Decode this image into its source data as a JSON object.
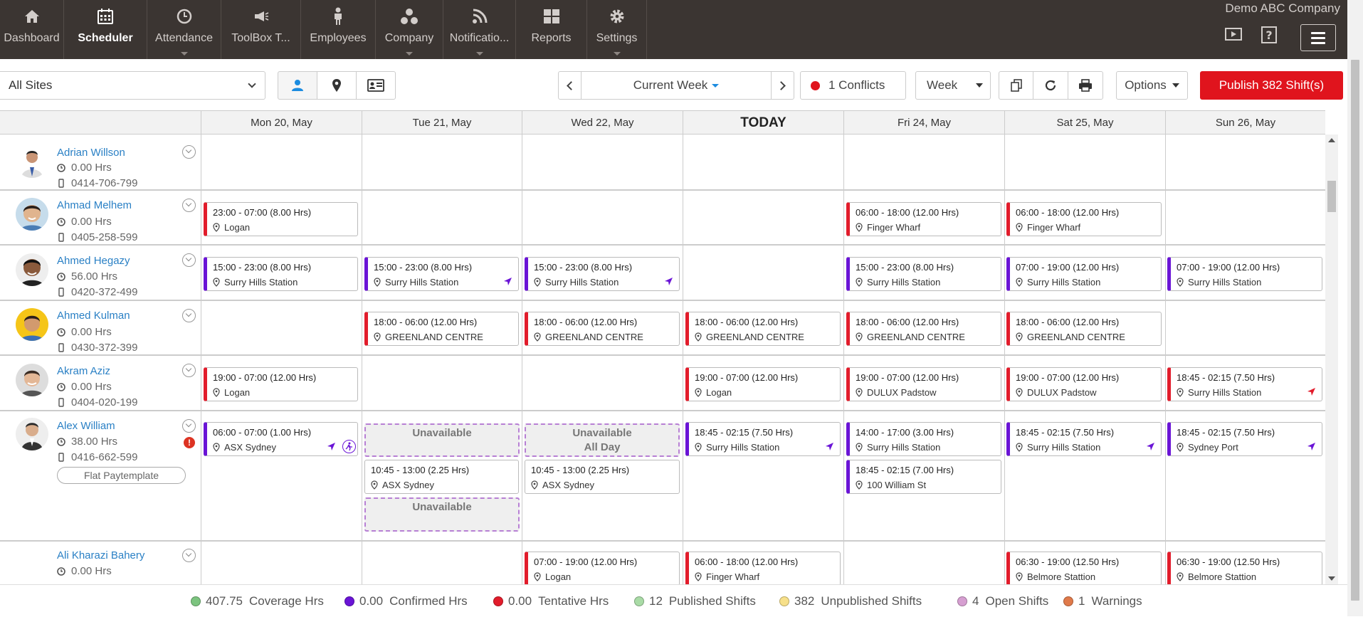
{
  "nav": {
    "items": [
      {
        "label": "Dashboard",
        "icon": "home-icon"
      },
      {
        "label": "Scheduler",
        "icon": "calendar-icon"
      },
      {
        "label": "Attendance",
        "icon": "clock-icon"
      },
      {
        "label": "ToolBox T...",
        "icon": "megaphone-icon"
      },
      {
        "label": "Employees",
        "icon": "person-icon"
      },
      {
        "label": "Company",
        "icon": "company-icon"
      },
      {
        "label": "Notificatio...",
        "icon": "rss-icon"
      },
      {
        "label": "Reports",
        "icon": "grid-icon"
      },
      {
        "label": "Settings",
        "icon": "gear-icon"
      }
    ],
    "company": "Demo ABC Company"
  },
  "toolbar": {
    "site": "All Sites",
    "week_label": "Current Week",
    "conflicts": "1 Conflicts",
    "view": "Week",
    "options": "Options",
    "publish": "Publish 382 Shift(s)"
  },
  "days": [
    "Mon 20, May",
    "Tue 21, May",
    "Wed 22, May",
    "TODAY",
    "Fri 24, May",
    "Sat 25, May",
    "Sun 26, May"
  ],
  "employees": [
    {
      "name": "Adrian Willson",
      "hrs": "0.00 Hrs",
      "phone": "0414-706-799"
    },
    {
      "name": "Ahmad Melhem",
      "hrs": "0.00 Hrs",
      "phone": "0405-258-599"
    },
    {
      "name": "Ahmed Hegazy",
      "hrs": "56.00 Hrs",
      "phone": "0420-372-499"
    },
    {
      "name": "Ahmed Kulman",
      "hrs": "0.00 Hrs",
      "phone": "0430-372-399"
    },
    {
      "name": "Akram Aziz",
      "hrs": "0.00 Hrs",
      "phone": "0404-020-199"
    },
    {
      "name": "Alex William",
      "hrs": "38.00 Hrs",
      "phone": "0416-662-599",
      "paytemplate": "Flat Paytemplate"
    },
    {
      "name": "Ali Kharazi Bahery",
      "hrs": "0.00 Hrs"
    }
  ],
  "shifts": [
    {
      "time": "23:00 - 07:00 (8.00 Hrs)",
      "loc": "Logan"
    },
    {
      "time": "06:00 - 18:00 (12.00 Hrs)",
      "loc": "Finger Wharf"
    },
    {
      "time": "06:00 - 18:00 (12.00 Hrs)",
      "loc": "Finger Wharf"
    },
    {
      "time": "15:00 - 23:00 (8.00 Hrs)",
      "loc": "Surry Hills Station"
    },
    {
      "time": "15:00 - 23:00 (8.00 Hrs)",
      "loc": "Surry Hills Station"
    },
    {
      "time": "15:00 - 23:00 (8.00 Hrs)",
      "loc": "Surry Hills Station"
    },
    {
      "time": "15:00 - 23:00 (8.00 Hrs)",
      "loc": "Surry Hills Station"
    },
    {
      "time": "07:00 - 19:00 (12.00 Hrs)",
      "loc": "Surry Hills Station"
    },
    {
      "time": "07:00 - 19:00 (12.00 Hrs)",
      "loc": "Surry Hills Station"
    },
    {
      "time": "18:00 - 06:00 (12.00 Hrs)",
      "loc": "GREENLAND CENTRE"
    },
    {
      "time": "18:00 - 06:00 (12.00 Hrs)",
      "loc": "GREENLAND CENTRE"
    },
    {
      "time": "18:00 - 06:00 (12.00 Hrs)",
      "loc": "GREENLAND CENTRE"
    },
    {
      "time": "18:00 - 06:00 (12.00 Hrs)",
      "loc": "GREENLAND CENTRE"
    },
    {
      "time": "18:00 - 06:00 (12.00 Hrs)",
      "loc": "GREENLAND CENTRE"
    },
    {
      "time": "19:00 - 07:00 (12.00 Hrs)",
      "loc": "Logan"
    },
    {
      "time": "19:00 - 07:00 (12.00 Hrs)",
      "loc": "Logan"
    },
    {
      "time": "19:00 - 07:00 (12.00 Hrs)",
      "loc": "DULUX Padstow"
    },
    {
      "time": "19:00 - 07:00 (12.00 Hrs)",
      "loc": "DULUX Padstow"
    },
    {
      "time": "18:45 - 02:15 (7.50 Hrs)",
      "loc": "Surry Hills Station"
    },
    {
      "time": "06:00 - 07:00 (1.00 Hrs)",
      "loc": "ASX Sydney"
    },
    {
      "time": "18:45 - 02:15 (7.50 Hrs)",
      "loc": "Surry Hills Station"
    },
    {
      "time": "14:00 - 17:00 (3.00 Hrs)",
      "loc": "Surry Hills Station"
    },
    {
      "time": "18:45 - 02:15 (7.50 Hrs)",
      "loc": "Surry Hills Station"
    },
    {
      "time": "18:45 - 02:15 (7.50 Hrs)",
      "loc": "Sydney Port"
    },
    {
      "time": "10:45 - 13:00 (2.25 Hrs)",
      "loc": "ASX Sydney"
    },
    {
      "time": "10:45 - 13:00 (2.25 Hrs)",
      "loc": "ASX Sydney"
    },
    {
      "time": "18:45 - 02:15 (7.00 Hrs)",
      "loc": "100 William St"
    },
    {
      "time": "07:00 - 19:00 (12.00 Hrs)",
      "loc": "Logan"
    },
    {
      "time": "06:00 - 18:00 (12.00 Hrs)",
      "loc": "Finger Wharf"
    },
    {
      "time": "06:30 - 19:00 (12.50 Hrs)",
      "loc": "Belmore Stattion"
    },
    {
      "time": "06:30 - 19:00 (12.50 Hrs)",
      "loc": "Belmore Stattion"
    }
  ],
  "unavailable": [
    "Unavailable",
    "Unavailable",
    "All Day",
    "Unavailable"
  ],
  "legend": [
    {
      "value": "407.75",
      "label": "Coverage Hrs",
      "color": "#7cc47f"
    },
    {
      "value": "0.00",
      "label": "Confirmed Hrs",
      "color": "#6a14d6"
    },
    {
      "value": "0.00",
      "label": "Tentative Hrs",
      "color": "#e21c2b"
    },
    {
      "value": "12",
      "label": "Published Shifts",
      "color": "#a9dba6"
    },
    {
      "value": "382",
      "label": "Unpublished Shifts",
      "color": "#f7e08a"
    },
    {
      "value": "4",
      "label": "Open Shifts",
      "color": "#d69fd1"
    },
    {
      "value": "1",
      "label": "Warnings",
      "color": "#e07a4a"
    }
  ]
}
